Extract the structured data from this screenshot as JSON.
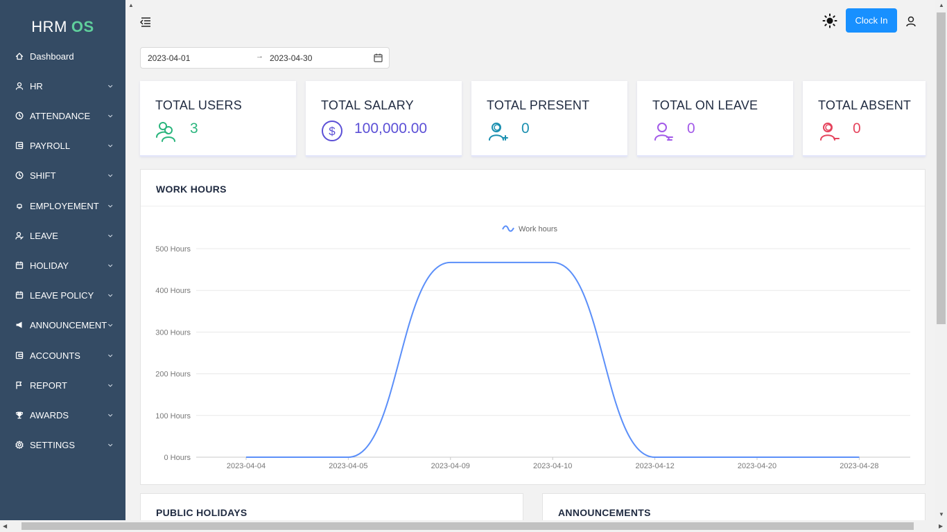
{
  "app": {
    "name": "HRM",
    "name_accent": "OS"
  },
  "sidebar": {
    "items": [
      {
        "label": "Dashboard",
        "icon": "home-icon",
        "has_submenu": false
      },
      {
        "label": "HR",
        "icon": "user-icon",
        "has_submenu": true
      },
      {
        "label": "ATTENDANCE",
        "icon": "clock-icon",
        "has_submenu": true
      },
      {
        "label": "PAYROLL",
        "icon": "wallet-icon",
        "has_submenu": true
      },
      {
        "label": "SHIFT",
        "icon": "clock-icon",
        "has_submenu": true
      },
      {
        "label": "EMPLOYEMENT",
        "icon": "bell-icon",
        "has_submenu": true
      },
      {
        "label": "LEAVE",
        "icon": "user-leave-icon",
        "has_submenu": true
      },
      {
        "label": "HOLIDAY",
        "icon": "calendar-icon",
        "has_submenu": true
      },
      {
        "label": "LEAVE POLICY",
        "icon": "calendar-icon",
        "has_submenu": true
      },
      {
        "label": "ANNOUNCEMENT",
        "icon": "megaphone-icon",
        "has_submenu": true
      },
      {
        "label": "ACCOUNTS",
        "icon": "wallet-icon",
        "has_submenu": true
      },
      {
        "label": "REPORT",
        "icon": "flag-icon",
        "has_submenu": true
      },
      {
        "label": "AWARDS",
        "icon": "trophy-icon",
        "has_submenu": true
      },
      {
        "label": "SETTINGS",
        "icon": "gear-icon",
        "has_submenu": true
      }
    ]
  },
  "topbar": {
    "clock_in_label": "Clock In",
    "theme_icon": "sun-icon",
    "user_icon": "user-icon",
    "menu_icon": "menu-fold-icon"
  },
  "date_range": {
    "start": "2023-04-01",
    "separator": "→",
    "end": "2023-04-30"
  },
  "stats": [
    {
      "title": "TOTAL USERS",
      "value": "3",
      "color": "#2ab57d",
      "icon": "users-icon"
    },
    {
      "title": "TOTAL SALARY",
      "value": "100,000.00",
      "color": "#5b4fd6",
      "icon": "dollar-icon"
    },
    {
      "title": "TOTAL PRESENT",
      "value": "0",
      "color": "#1a8fb0",
      "icon": "user-add-icon"
    },
    {
      "title": "TOTAL ON LEAVE",
      "value": "0",
      "color": "#a259e8",
      "icon": "user-leave-icon"
    },
    {
      "title": "TOTAL ABSENT",
      "value": "0",
      "color": "#e5435c",
      "icon": "user-remove-icon"
    }
  ],
  "work_hours": {
    "title": "WORK HOURS",
    "chart_data": {
      "type": "line",
      "title": "",
      "xlabel": "",
      "ylabel": "",
      "x": [
        "2023-04-04",
        "2023-04-05",
        "2023-04-09",
        "2023-04-10",
        "2023-04-12",
        "2023-04-20",
        "2023-04-28"
      ],
      "y_ticks": [
        "0 Hours",
        "100 Hours",
        "200 Hours",
        "300 Hours",
        "400 Hours",
        "500 Hours"
      ],
      "ylim": [
        0,
        500
      ],
      "series": [
        {
          "name": "Work hours",
          "color": "#5b8ff9",
          "values": [
            0,
            0,
            467,
            467,
            0,
            0,
            0
          ]
        }
      ],
      "legend": "top-center",
      "grid": true,
      "smooth": true
    }
  },
  "bottom": {
    "holidays_title": "PUBLIC HOLIDAYS",
    "announcements_title": "ANNOUNCEMENTS"
  }
}
